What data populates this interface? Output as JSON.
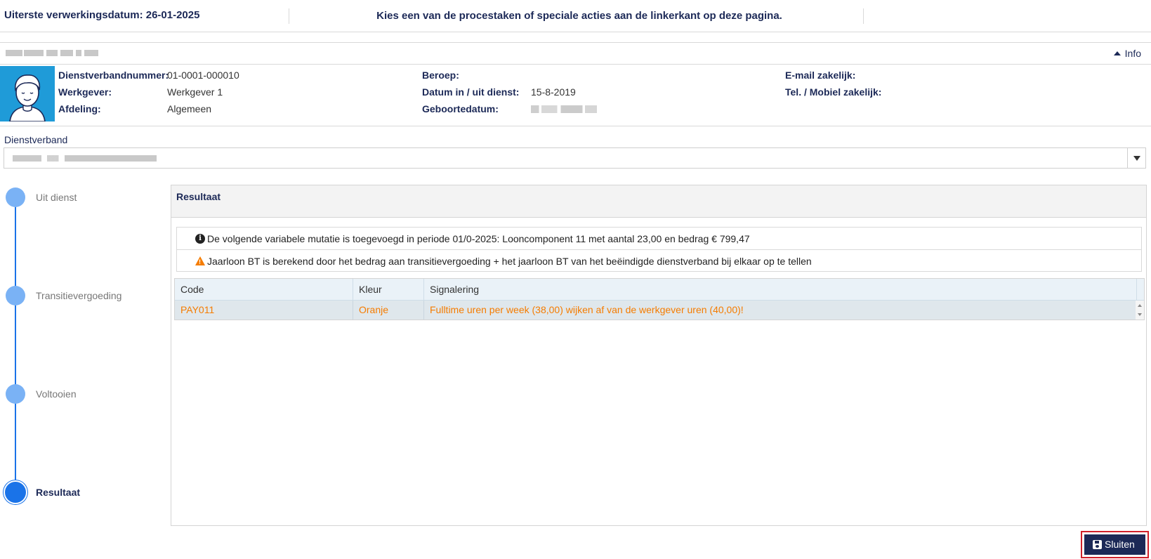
{
  "header": {
    "deadline": "Uiterste verwerkingsdatum: 26-01-2025",
    "message": "Kies een van de procestaken of speciale acties aan de linkerkant op deze pagina."
  },
  "employee": {
    "info_toggle": "Info",
    "fields": {
      "dienstverbandnummer_label": "Dienstverbandnummer:",
      "dienstverbandnummer_value": "01-0001-000010",
      "werkgever_label": "Werkgever:",
      "werkgever_value": "Werkgever 1",
      "afdeling_label": "Afdeling:",
      "afdeling_value": "Algemeen",
      "beroep_label": "Beroep:",
      "beroep_value": "",
      "datum_label": "Datum in / uit dienst:",
      "datum_value": "15-8-2019",
      "geboortedatum_label": "Geboortedatum:",
      "email_label": "E-mail zakelijk:",
      "email_value": "",
      "tel_label": "Tel. / Mobiel zakelijk:",
      "tel_value": ""
    }
  },
  "dienstverband": {
    "label": "Dienstverband"
  },
  "steps": [
    {
      "label": "Uit dienst",
      "state": "done"
    },
    {
      "label": "Transitievergoeding",
      "state": "done"
    },
    {
      "label": "Voltooien",
      "state": "done"
    },
    {
      "label": "Resultaat",
      "state": "active"
    }
  ],
  "result": {
    "title": "Resultaat",
    "messages": [
      {
        "type": "info",
        "icon": "info-icon",
        "text": "De volgende variabele mutatie is toegevoegd in periode 01/0-2025: Looncomponent 11 met aantal 23,00 en bedrag € 799,47"
      },
      {
        "type": "warning",
        "icon": "warning-icon",
        "text": "Jaarloon BT is berekend door het bedrag aan transitievergoeding + het jaarloon BT van het beëindigde dienstverband bij elkaar op te tellen"
      }
    ],
    "table": {
      "columns": [
        "Code",
        "Kleur",
        "Signalering"
      ],
      "rows": [
        [
          "PAY011",
          "Oranje",
          "Fulltime uren per week (38,00) wijken af van de werkgever uren (40,00)!"
        ]
      ]
    }
  },
  "actions": {
    "close_label": "Sluiten"
  },
  "colors": {
    "primary": "#1c2957",
    "step_active": "#1a73e8",
    "step_done": "#7ab2f5",
    "warning": "#f57c00",
    "avatar_bg": "#1f9bd8",
    "highlight_border": "#d0202a"
  }
}
